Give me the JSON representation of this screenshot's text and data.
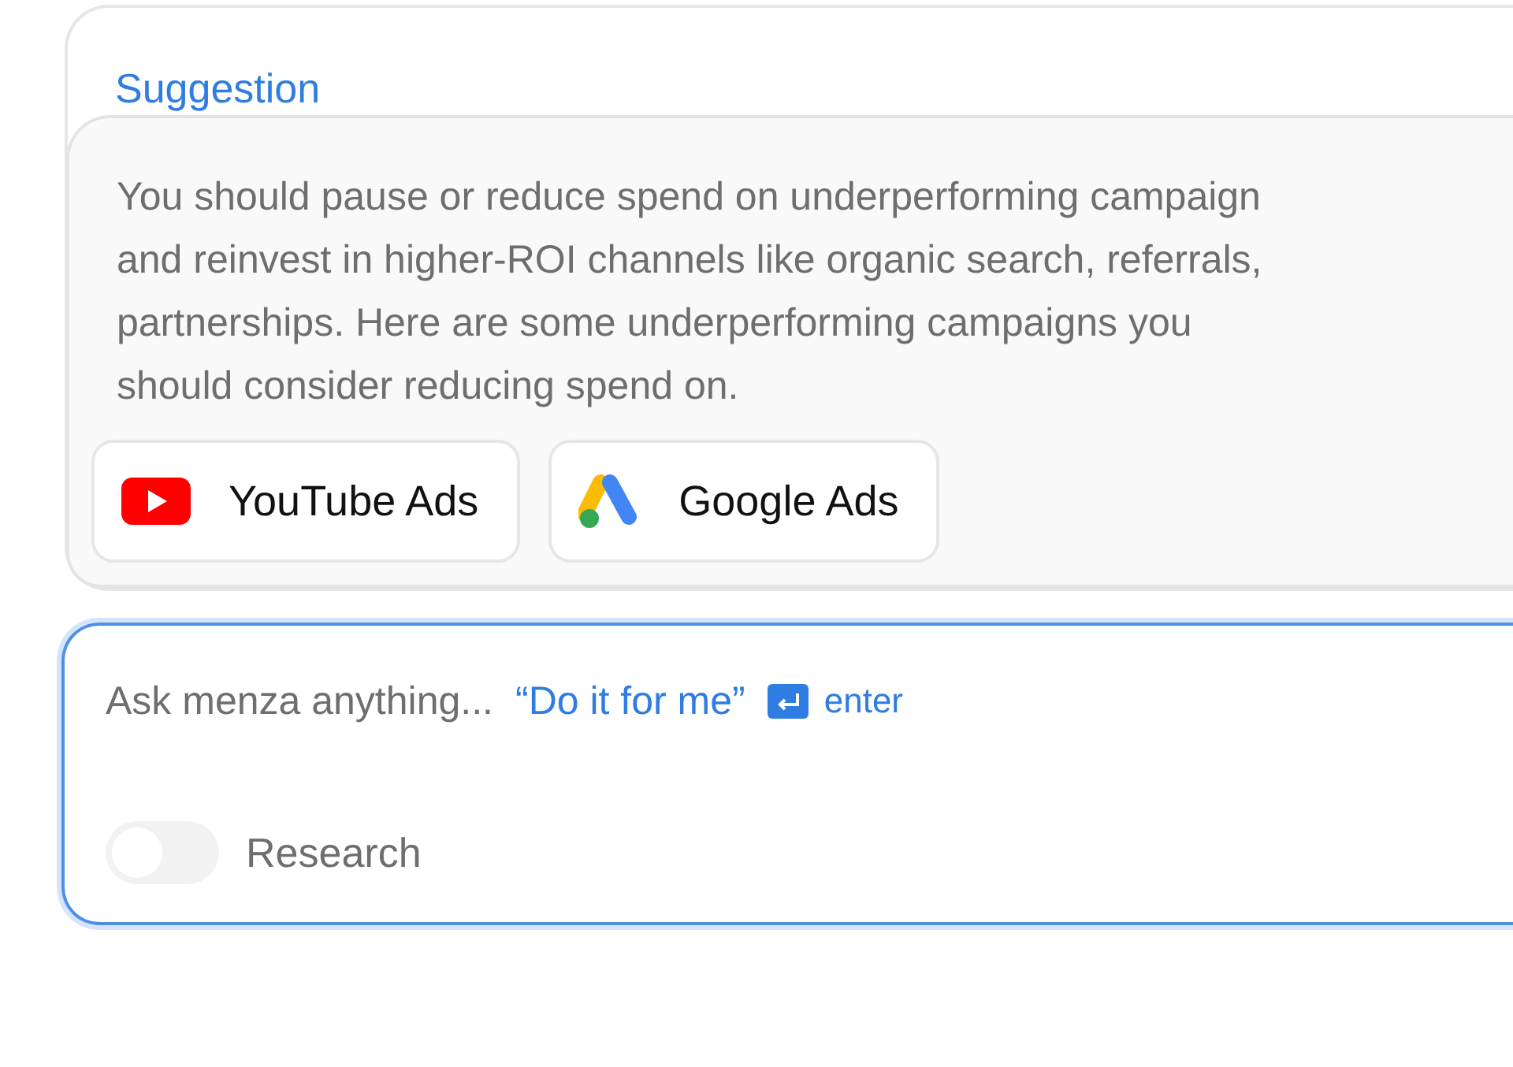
{
  "suggestion": {
    "title": "Suggestion",
    "message": "You should pause or reduce spend on underperforming campaign\nand reinvest in higher-ROI channels like organic search, referrals,\npartnerships. Here are some underperforming campaigns you\nshould consider reducing spend on.",
    "campaigns": [
      {
        "kind": "youtube",
        "label": "YouTube Ads"
      },
      {
        "kind": "google-ads",
        "label": "Google Ads"
      }
    ]
  },
  "composer": {
    "placeholder": "Ask menza anything...",
    "hint": "“Do it for me”",
    "shortcut": "enter",
    "research": {
      "label": "Research",
      "on": false
    }
  }
}
